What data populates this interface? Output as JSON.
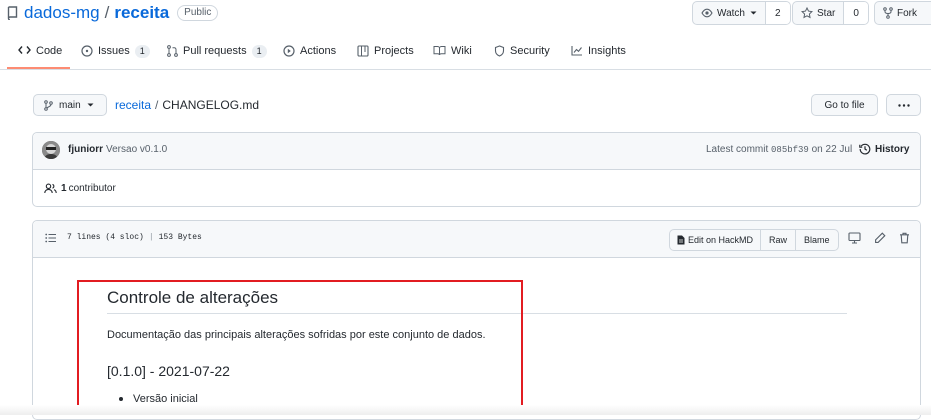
{
  "repo": {
    "owner": "dados-mg",
    "separator": "/",
    "name": "receita",
    "visibility": "Public"
  },
  "actions": {
    "watch_label": "Watch",
    "watch_count": "2",
    "star_label": "Star",
    "star_count": "0",
    "fork_label": "Fork"
  },
  "tabs": [
    {
      "label": "Code",
      "icon": "code-icon",
      "selected": true
    },
    {
      "label": "Issues",
      "icon": "issue-opened-icon",
      "count": "1"
    },
    {
      "label": "Pull requests",
      "icon": "git-pull-request-icon",
      "count": "1"
    },
    {
      "label": "Actions",
      "icon": "play-icon"
    },
    {
      "label": "Projects",
      "icon": "table-icon"
    },
    {
      "label": "Wiki",
      "icon": "book-icon"
    },
    {
      "label": "Security",
      "icon": "shield-icon"
    },
    {
      "label": "Insights",
      "icon": "graph-icon"
    }
  ],
  "branch": {
    "name": "main",
    "breadcrumb_repo": "receita",
    "breadcrumb_sep": "/",
    "file_name": "CHANGELOG.md",
    "go_to_file": "Go to file"
  },
  "commit": {
    "author": "fjuniorr",
    "message": "Versao v0.1.0",
    "latest_label": "Latest commit",
    "sha": "085bf39",
    "date": "on 22 Jul",
    "history_label": "History",
    "contributors_count": "1",
    "contributors_label": "contributor"
  },
  "file": {
    "lines": "7 lines (4 sloc)",
    "size": "153 Bytes",
    "edit_hackmd": "Edit on HackMD",
    "raw": "Raw",
    "blame": "Blame"
  },
  "markdown": {
    "h1": "Controle de alterações",
    "paragraph": "Documentação das principais alterações sofridas por este conjunto de dados.",
    "h2": "[0.1.0] - 2021-07-22",
    "list_items": [
      "Versão inicial"
    ]
  },
  "colors": {
    "link": "#0969da",
    "tab_underline": "#fd8c73",
    "highlight_box": "#e21c21"
  }
}
